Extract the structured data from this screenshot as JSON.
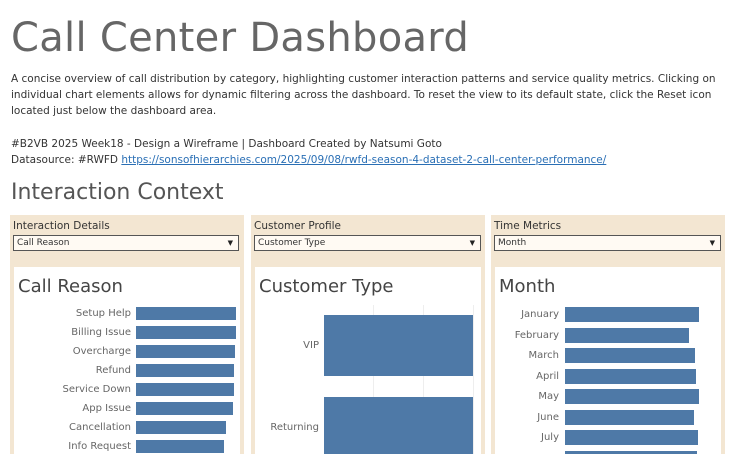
{
  "header": {
    "title": "Call Center Dashboard",
    "description": "A concise overview of call distribution by category, highlighting customer interaction patterns and service quality metrics. Clicking on individual chart elements allows for dynamic filtering across the dashboard. To reset the view to its default state, click the Reset icon located just below the dashboard area.",
    "credit": "#B2VB 2025 Week18 -  Design a Wireframe | Dashboard Created by Natsumi Goto",
    "datasource_label": "Datasource: #RWFD ",
    "datasource_link": "https://sonsofhierarchies.com/2025/09/08/rwfd-season-4-dataset-2-call-center-performance/"
  },
  "section": {
    "title": "Interaction Context"
  },
  "panels": [
    {
      "label": "Interaction Details",
      "selected": "Call Reason",
      "card_title": "Call Reason",
      "chart_data": {
        "type": "bar",
        "categories": [
          "Setup Help",
          "Billing Issue",
          "Overcharge",
          "Refund",
          "Service Down",
          "App Issue",
          "Cancellation",
          "Info Request"
        ],
        "values": [
          1.0,
          0.997,
          0.985,
          0.98,
          0.975,
          0.965,
          0.895,
          0.88
        ]
      }
    },
    {
      "label": "Customer Profile",
      "selected": "Customer Type",
      "card_title": "Customer Type",
      "chart_data": {
        "type": "bar",
        "categories": [
          "VIP",
          "Returning"
        ],
        "values": [
          1.0,
          1.0
        ]
      }
    },
    {
      "label": "Time Metrics",
      "selected": "Month",
      "card_title": "Month",
      "chart_data": {
        "type": "bar",
        "categories": [
          "January",
          "February",
          "March",
          "April",
          "May",
          "June",
          "July"
        ],
        "values": [
          0.985,
          0.915,
          0.955,
          0.965,
          0.985,
          0.945,
          0.975
        ]
      }
    }
  ],
  "colors": {
    "bar": "#4e79a7",
    "panel_bg": "#f3e6d2",
    "link": "#2a6fb5"
  }
}
